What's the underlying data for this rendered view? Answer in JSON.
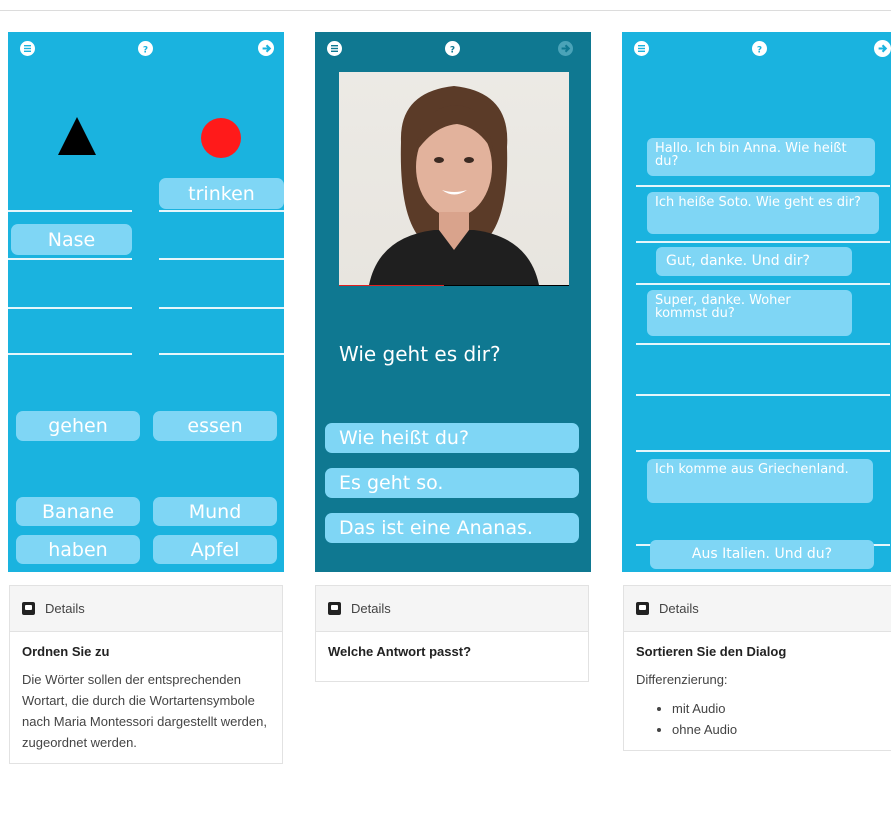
{
  "cards": [
    {
      "left_words": [
        "Nase",
        "gehen",
        "Banane",
        "haben"
      ],
      "right_words": [
        "trinken",
        "essen",
        "Mund",
        "Apfel"
      ]
    },
    {
      "question": "Wie geht es dir?",
      "answers": [
        "Wie heißt du?",
        "Es geht so.",
        "Das ist eine Ananas."
      ]
    },
    {
      "lines": [
        "Hallo. Ich bin Anna. Wie heißt du?",
        "Ich heiße Soto. Wie geht es dir?",
        "Gut, danke. Und dir?",
        "Super, danke. Woher kommst du?",
        "Ich komme aus Griechenland.",
        "Aus Italien. Und du?"
      ]
    }
  ],
  "panels": [
    {
      "details_label": "Details",
      "title": "Ordnen Sie zu",
      "text": "Die Wörter sollen der entsprechenden Wortart, die durch die Wortartensymbole nach Maria Montessori dargestellt werden, zugeordnet werden."
    },
    {
      "details_label": "Details",
      "title": "Welche Antwort passt?"
    },
    {
      "details_label": "Details",
      "title": "Sortieren Sie den Dialog",
      "text": "Differenzierung:",
      "bullets": [
        "mit Audio",
        "ohne Audio"
      ]
    }
  ],
  "colors": {
    "card_light": "#1ab3df",
    "card_dark": "#0f7891",
    "pill": "#7fd6f5",
    "red_dot": "#ff1a1a"
  }
}
